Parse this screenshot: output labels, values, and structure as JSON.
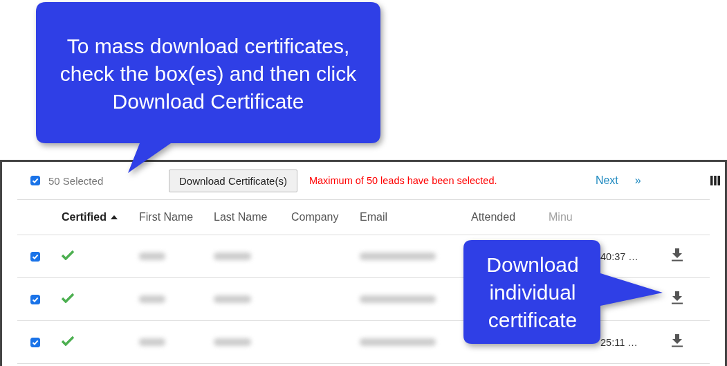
{
  "callouts": [
    {
      "text": "To mass download certificates, check the box(es) and then click Download Certificate",
      "kind": "top"
    },
    {
      "text": "Download individual certificate",
      "kind": "side"
    }
  ],
  "toolbar": {
    "select_all_checked": true,
    "selected_count": "50 Selected",
    "download_button": "Download Certificate(s)",
    "warning": "Maximum of 50 leads have been selected.",
    "next": "Next",
    "last": "»"
  },
  "table": {
    "columns": [
      {
        "label": "Certified",
        "sorted": true
      },
      {
        "label": "First Name",
        "sorted": false
      },
      {
        "label": "Last Name",
        "sorted": false
      },
      {
        "label": "Company",
        "sorted": false
      },
      {
        "label": "Email",
        "sorted": false
      },
      {
        "label": "Attended",
        "sorted": false
      },
      {
        "label": "Minu",
        "sorted": false
      }
    ],
    "rows": [
      {
        "checked": true,
        "certified": true,
        "time": "40:37 …"
      },
      {
        "checked": true,
        "certified": true
      },
      {
        "checked": true,
        "certified": true,
        "time": "25:11 …"
      }
    ]
  }
}
